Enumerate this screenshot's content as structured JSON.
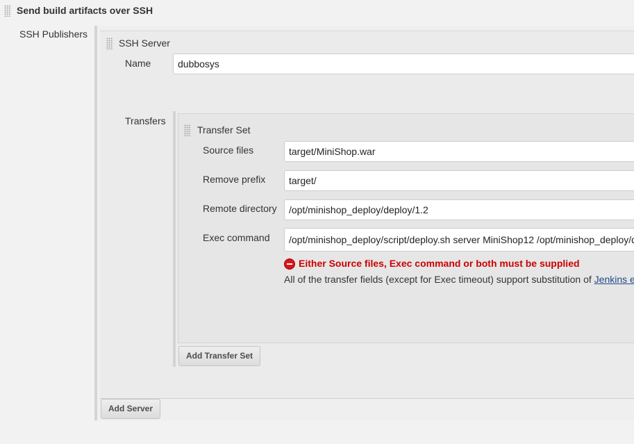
{
  "section": {
    "title": "Send build artifacts over SSH"
  },
  "publishers": {
    "label": "SSH Publishers"
  },
  "server": {
    "title": "SSH Server",
    "name_label": "Name",
    "name_value": "dubbosys",
    "transfers_label": "Transfers"
  },
  "transfer_set": {
    "title": "Transfer Set",
    "source_files_label": "Source files",
    "source_files_value": "target/MiniShop.war",
    "remove_prefix_label": "Remove prefix",
    "remove_prefix_value": "target/",
    "remote_directory_label": "Remote directory",
    "remote_directory_value": "/opt/minishop_deploy/deploy/1.2",
    "exec_command_label": "Exec command",
    "exec_command_value": "/opt/minishop_deploy/script/deploy.sh server MiniShop12 /opt/minishop_deploy/d",
    "error_message": "Either Source files, Exec command or both must be supplied",
    "help_text": "All of the transfer fields (except for Exec timeout) support substitution of ",
    "help_link": "Jenkins e"
  },
  "buttons": {
    "add_transfer_set": "Add Transfer Set",
    "add_server": "Add Server"
  },
  "colors": {
    "error": "#cc0000",
    "link": "#204a87",
    "panel": "#e8e8e8"
  }
}
